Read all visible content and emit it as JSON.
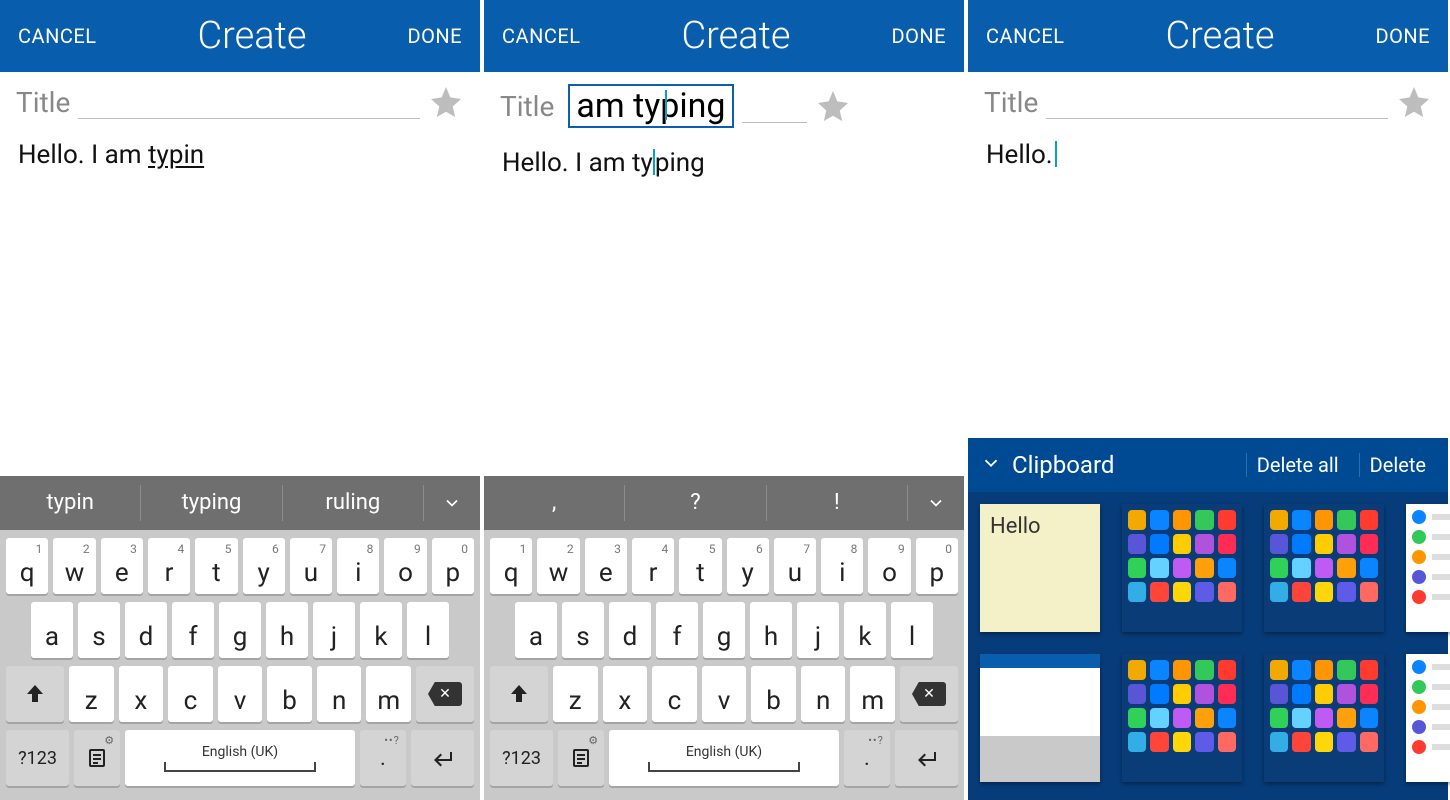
{
  "header": {
    "cancel": "CANCEL",
    "title": "Create",
    "done": "DONE"
  },
  "title_placeholder": "Title",
  "panes": [
    {
      "body_text": "Hello. I am ",
      "body_word": "typin",
      "body_word_underlined": true,
      "suggestions": [
        "typin",
        "typing",
        "ruling"
      ]
    },
    {
      "magnify_text": "am typing",
      "body_prefix": "Hello. I am ty",
      "body_suffix": "ping",
      "suggestions": [
        ",",
        "?",
        "!"
      ]
    },
    {
      "body_text": "Hello.",
      "caret_after": true
    }
  ],
  "keyboard": {
    "row1": [
      [
        "q",
        "1"
      ],
      [
        "w",
        "2"
      ],
      [
        "e",
        "3"
      ],
      [
        "r",
        "4"
      ],
      [
        "t",
        "5"
      ],
      [
        "y",
        "6"
      ],
      [
        "u",
        "7"
      ],
      [
        "i",
        "8"
      ],
      [
        "o",
        "9"
      ],
      [
        "p",
        "0"
      ]
    ],
    "row2": [
      "a",
      "s",
      "d",
      "f",
      "g",
      "h",
      "j",
      "k",
      "l"
    ],
    "row3": [
      "z",
      "x",
      "c",
      "v",
      "b",
      "n",
      "m"
    ],
    "fn_sym": "?123",
    "space_label": "English (UK)",
    "period_key": "."
  },
  "clipboard": {
    "label": "Clipboard",
    "delete_all": "Delete all",
    "delete": "Delete",
    "note_text": "Hello",
    "app_colors": [
      "#f2a900",
      "#0a84ff",
      "#ff9500",
      "#34c759",
      "#ff3b30",
      "#5856d6",
      "#007aff",
      "#ffcc00",
      "#af52de",
      "#ff2d55",
      "#30d158",
      "#64d2ff",
      "#bf5af2",
      "#ff9f0a",
      "#0a84ff",
      "#32ade6",
      "#ff453a",
      "#ffd60a",
      "#5e5ce6",
      "#ff6961"
    ],
    "contact_colors": [
      "#0a84ff",
      "#34c759",
      "#ff9500",
      "#5856d6",
      "#ff3b30"
    ]
  }
}
